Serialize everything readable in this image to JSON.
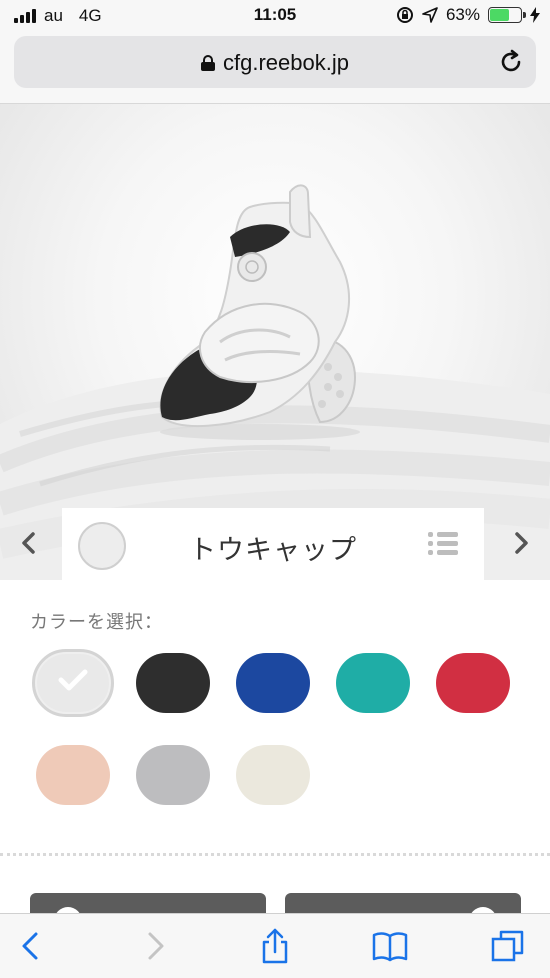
{
  "status_bar": {
    "carrier": "au",
    "network": "4G",
    "time": "11:05",
    "battery_percent": "63%",
    "battery_level": 0.63
  },
  "browser": {
    "url": "cfg.reebok.jp"
  },
  "part_selector": {
    "part_name": "トウキャップ"
  },
  "color_picker": {
    "label": "カラーを選択：",
    "colors": [
      {
        "name": "white",
        "hex": "#e9e9e9",
        "selected": true
      },
      {
        "name": "black",
        "hex": "#2e2e2e",
        "selected": false
      },
      {
        "name": "blue",
        "hex": "#1c48a0",
        "selected": false
      },
      {
        "name": "teal",
        "hex": "#1fada6",
        "selected": false
      },
      {
        "name": "red",
        "hex": "#d12f42",
        "selected": false
      },
      {
        "name": "peach",
        "hex": "#efcab8",
        "selected": false
      },
      {
        "name": "gray",
        "hex": "#bdbdbf",
        "selected": false
      },
      {
        "name": "cream",
        "hex": "#ebe8dd",
        "selected": false
      }
    ]
  },
  "icons": {
    "back": "chevron-left-icon",
    "forward": "chevron-right-icon",
    "share": "share-icon",
    "bookmarks": "book-icon",
    "tabs": "tabs-icon"
  }
}
